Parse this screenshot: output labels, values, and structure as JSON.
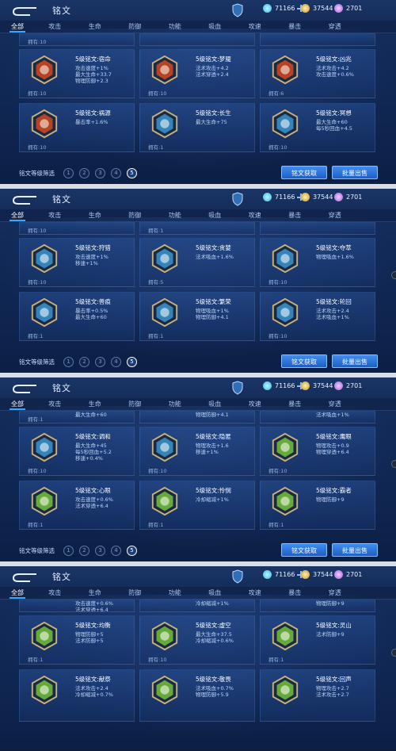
{
  "header": {
    "title": "铭文",
    "currency_crystal": "71166",
    "currency_gold": "37544",
    "currency_gem": "2701"
  },
  "tabs": [
    "全部",
    "攻击",
    "生命",
    "防御",
    "功能",
    "吸血",
    "攻速",
    "暴击",
    "穿透"
  ],
  "filter": {
    "label": "铭文等级筛选",
    "levels": [
      "1",
      "2",
      "3",
      "4",
      "5"
    ],
    "selected": "5"
  },
  "buttons": {
    "acquire": "铭文获取",
    "sell": "批量出售"
  },
  "colors": {
    "accent": "#3aa7ff",
    "red": "#c8461e",
    "blue": "#3a8fc8",
    "green": "#6fb83a"
  },
  "panels": [
    {
      "top_owned": [
        "拥有:10",
        "",
        ""
      ],
      "rows": [
        [
          {
            "name": "5级铭文:宿命",
            "stats": [
              "攻击速度+1%",
              "最大生命+33.7",
              "物理防御+2.3"
            ],
            "owned": "拥有:10",
            "color": "red"
          },
          {
            "name": "5级铭文:梦魇",
            "stats": [
              "法术攻击+4.2",
              "法术穿透+2.4"
            ],
            "owned": "拥有:10",
            "color": "red"
          },
          {
            "name": "5级铭文:凶兆",
            "stats": [
              "法术攻击+4.2",
              "攻击速度+0.6%"
            ],
            "owned": "拥有:6",
            "color": "red"
          }
        ],
        [
          {
            "name": "5级铭文:祸源",
            "stats": [
              "暴击率+1.6%"
            ],
            "owned": "拥有:10",
            "color": "red"
          },
          {
            "name": "5级铭文:长生",
            "stats": [
              "最大生命+75"
            ],
            "owned": "拥有:1",
            "color": "blue"
          },
          {
            "name": "5级铭文:冥想",
            "stats": [
              "最大生命+60",
              "每5秒回血+4.5"
            ],
            "owned": "拥有:10",
            "color": "blue"
          }
        ]
      ]
    },
    {
      "top_owned": [
        "拥有:10",
        "拥有:1",
        ""
      ],
      "rows": [
        [
          {
            "name": "5级铭文:狩猎",
            "stats": [
              "攻击速度+1%",
              "移速+1%"
            ],
            "owned": "拥有:10",
            "color": "blue"
          },
          {
            "name": "5级铭文:贪婪",
            "stats": [
              "法术吸血+1.6%"
            ],
            "owned": "拥有:5",
            "color": "blue"
          },
          {
            "name": "5级铭文:夺萃",
            "stats": [
              "物理吸血+1.6%"
            ],
            "owned": "拥有:10",
            "color": "blue"
          }
        ],
        [
          {
            "name": "5级铭文:兽痕",
            "stats": [
              "暴击率+0.5%",
              "最大生命+60"
            ],
            "owned": "拥有:1",
            "color": "blue"
          },
          {
            "name": "5级铭文:繁荣",
            "stats": [
              "物理吸血+1%",
              "物理防御+4.1"
            ],
            "owned": "拥有:1",
            "color": "blue"
          },
          {
            "name": "5级铭文:轮回",
            "stats": [
              "法术攻击+2.4",
              "法术吸血+1%"
            ],
            "owned": "拥有:10",
            "color": "blue"
          }
        ]
      ]
    },
    {
      "top_owned": [
        "拥有:1",
        "",
        ""
      ],
      "top_stats": [
        "最大生命+60",
        "物理防御+4.1",
        "法术吸血+1%"
      ],
      "rows": [
        [
          {
            "name": "5级铭文:调和",
            "stats": [
              "最大生命+45",
              "每5秒回血+5.2",
              "移速+0.4%"
            ],
            "owned": "拥有:10",
            "color": "blue"
          },
          {
            "name": "5级铭文:隐匿",
            "stats": [
              "物理攻击+1.6",
              "移速+1%"
            ],
            "owned": "拥有:10",
            "color": "blue"
          },
          {
            "name": "5级铭文:鹰眼",
            "stats": [
              "物理攻击+0.9",
              "物理穿透+6.4"
            ],
            "owned": "拥有:10",
            "color": "green"
          }
        ],
        [
          {
            "name": "5级铭文:心眼",
            "stats": [
              "攻击速度+0.6%",
              "法术穿透+6.4"
            ],
            "owned": "拥有:1",
            "color": "green"
          },
          {
            "name": "5级铭文:怜悯",
            "stats": [
              "冷却缩减+1%"
            ],
            "owned": "拥有:1",
            "color": "green"
          },
          {
            "name": "5级铭文:霸者",
            "stats": [
              "物理防御+9"
            ],
            "owned": "拥有:1",
            "color": "green"
          }
        ]
      ]
    },
    {
      "top_owned": [
        "",
        "",
        ""
      ],
      "top_stats": [
        "攻击速度+0.6%",
        "冷却缩减+1%",
        "物理防御+9"
      ],
      "top_stats2": [
        "法术穿透+6.4",
        "",
        ""
      ],
      "rows": [
        [
          {
            "name": "5级铭文:均衡",
            "stats": [
              "物理防御+5",
              "法术防御+5"
            ],
            "owned": "拥有:1",
            "color": "green"
          },
          {
            "name": "5级铭文:虚空",
            "stats": [
              "最大生命+37.5",
              "冷却缩减+0.6%"
            ],
            "owned": "拥有:10",
            "color": "green"
          },
          {
            "name": "5级铭文:灵山",
            "stats": [
              "法术防御+9"
            ],
            "owned": "拥有:1",
            "color": "green"
          }
        ],
        [
          {
            "name": "5级铭文:献祭",
            "stats": [
              "法术攻击+2.4",
              "冷却缩减+0.7%"
            ],
            "owned": "",
            "color": "green"
          },
          {
            "name": "5级铭文:敬畏",
            "stats": [
              "法术吸血+0.7%",
              "物理防御+5.9"
            ],
            "owned": "",
            "color": "green"
          },
          {
            "name": "5级铭文:回声",
            "stats": [
              "物理攻击+2.7",
              "法术攻击+2.7"
            ],
            "owned": "",
            "color": "green"
          }
        ]
      ]
    }
  ]
}
